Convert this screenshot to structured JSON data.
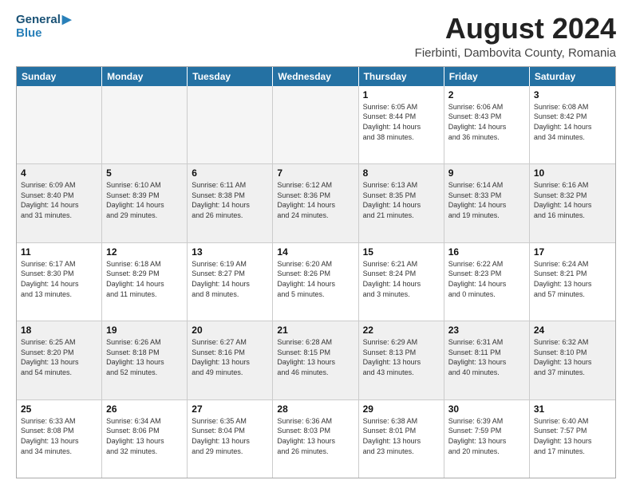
{
  "logo": {
    "line1": "General",
    "line2": "Blue"
  },
  "title": "August 2024",
  "location": "Fierbinti, Dambovita County, Romania",
  "weekdays": [
    "Sunday",
    "Monday",
    "Tuesday",
    "Wednesday",
    "Thursday",
    "Friday",
    "Saturday"
  ],
  "weeks": [
    [
      {
        "day": "",
        "info": ""
      },
      {
        "day": "",
        "info": ""
      },
      {
        "day": "",
        "info": ""
      },
      {
        "day": "",
        "info": ""
      },
      {
        "day": "1",
        "info": "Sunrise: 6:05 AM\nSunset: 8:44 PM\nDaylight: 14 hours\nand 38 minutes."
      },
      {
        "day": "2",
        "info": "Sunrise: 6:06 AM\nSunset: 8:43 PM\nDaylight: 14 hours\nand 36 minutes."
      },
      {
        "day": "3",
        "info": "Sunrise: 6:08 AM\nSunset: 8:42 PM\nDaylight: 14 hours\nand 34 minutes."
      }
    ],
    [
      {
        "day": "4",
        "info": "Sunrise: 6:09 AM\nSunset: 8:40 PM\nDaylight: 14 hours\nand 31 minutes."
      },
      {
        "day": "5",
        "info": "Sunrise: 6:10 AM\nSunset: 8:39 PM\nDaylight: 14 hours\nand 29 minutes."
      },
      {
        "day": "6",
        "info": "Sunrise: 6:11 AM\nSunset: 8:38 PM\nDaylight: 14 hours\nand 26 minutes."
      },
      {
        "day": "7",
        "info": "Sunrise: 6:12 AM\nSunset: 8:36 PM\nDaylight: 14 hours\nand 24 minutes."
      },
      {
        "day": "8",
        "info": "Sunrise: 6:13 AM\nSunset: 8:35 PM\nDaylight: 14 hours\nand 21 minutes."
      },
      {
        "day": "9",
        "info": "Sunrise: 6:14 AM\nSunset: 8:33 PM\nDaylight: 14 hours\nand 19 minutes."
      },
      {
        "day": "10",
        "info": "Sunrise: 6:16 AM\nSunset: 8:32 PM\nDaylight: 14 hours\nand 16 minutes."
      }
    ],
    [
      {
        "day": "11",
        "info": "Sunrise: 6:17 AM\nSunset: 8:30 PM\nDaylight: 14 hours\nand 13 minutes."
      },
      {
        "day": "12",
        "info": "Sunrise: 6:18 AM\nSunset: 8:29 PM\nDaylight: 14 hours\nand 11 minutes."
      },
      {
        "day": "13",
        "info": "Sunrise: 6:19 AM\nSunset: 8:27 PM\nDaylight: 14 hours\nand 8 minutes."
      },
      {
        "day": "14",
        "info": "Sunrise: 6:20 AM\nSunset: 8:26 PM\nDaylight: 14 hours\nand 5 minutes."
      },
      {
        "day": "15",
        "info": "Sunrise: 6:21 AM\nSunset: 8:24 PM\nDaylight: 14 hours\nand 3 minutes."
      },
      {
        "day": "16",
        "info": "Sunrise: 6:22 AM\nSunset: 8:23 PM\nDaylight: 14 hours\nand 0 minutes."
      },
      {
        "day": "17",
        "info": "Sunrise: 6:24 AM\nSunset: 8:21 PM\nDaylight: 13 hours\nand 57 minutes."
      }
    ],
    [
      {
        "day": "18",
        "info": "Sunrise: 6:25 AM\nSunset: 8:20 PM\nDaylight: 13 hours\nand 54 minutes."
      },
      {
        "day": "19",
        "info": "Sunrise: 6:26 AM\nSunset: 8:18 PM\nDaylight: 13 hours\nand 52 minutes."
      },
      {
        "day": "20",
        "info": "Sunrise: 6:27 AM\nSunset: 8:16 PM\nDaylight: 13 hours\nand 49 minutes."
      },
      {
        "day": "21",
        "info": "Sunrise: 6:28 AM\nSunset: 8:15 PM\nDaylight: 13 hours\nand 46 minutes."
      },
      {
        "day": "22",
        "info": "Sunrise: 6:29 AM\nSunset: 8:13 PM\nDaylight: 13 hours\nand 43 minutes."
      },
      {
        "day": "23",
        "info": "Sunrise: 6:31 AM\nSunset: 8:11 PM\nDaylight: 13 hours\nand 40 minutes."
      },
      {
        "day": "24",
        "info": "Sunrise: 6:32 AM\nSunset: 8:10 PM\nDaylight: 13 hours\nand 37 minutes."
      }
    ],
    [
      {
        "day": "25",
        "info": "Sunrise: 6:33 AM\nSunset: 8:08 PM\nDaylight: 13 hours\nand 34 minutes."
      },
      {
        "day": "26",
        "info": "Sunrise: 6:34 AM\nSunset: 8:06 PM\nDaylight: 13 hours\nand 32 minutes."
      },
      {
        "day": "27",
        "info": "Sunrise: 6:35 AM\nSunset: 8:04 PM\nDaylight: 13 hours\nand 29 minutes."
      },
      {
        "day": "28",
        "info": "Sunrise: 6:36 AM\nSunset: 8:03 PM\nDaylight: 13 hours\nand 26 minutes."
      },
      {
        "day": "29",
        "info": "Sunrise: 6:38 AM\nSunset: 8:01 PM\nDaylight: 13 hours\nand 23 minutes."
      },
      {
        "day": "30",
        "info": "Sunrise: 6:39 AM\nSunset: 7:59 PM\nDaylight: 13 hours\nand 20 minutes."
      },
      {
        "day": "31",
        "info": "Sunrise: 6:40 AM\nSunset: 7:57 PM\nDaylight: 13 hours\nand 17 minutes."
      }
    ]
  ]
}
